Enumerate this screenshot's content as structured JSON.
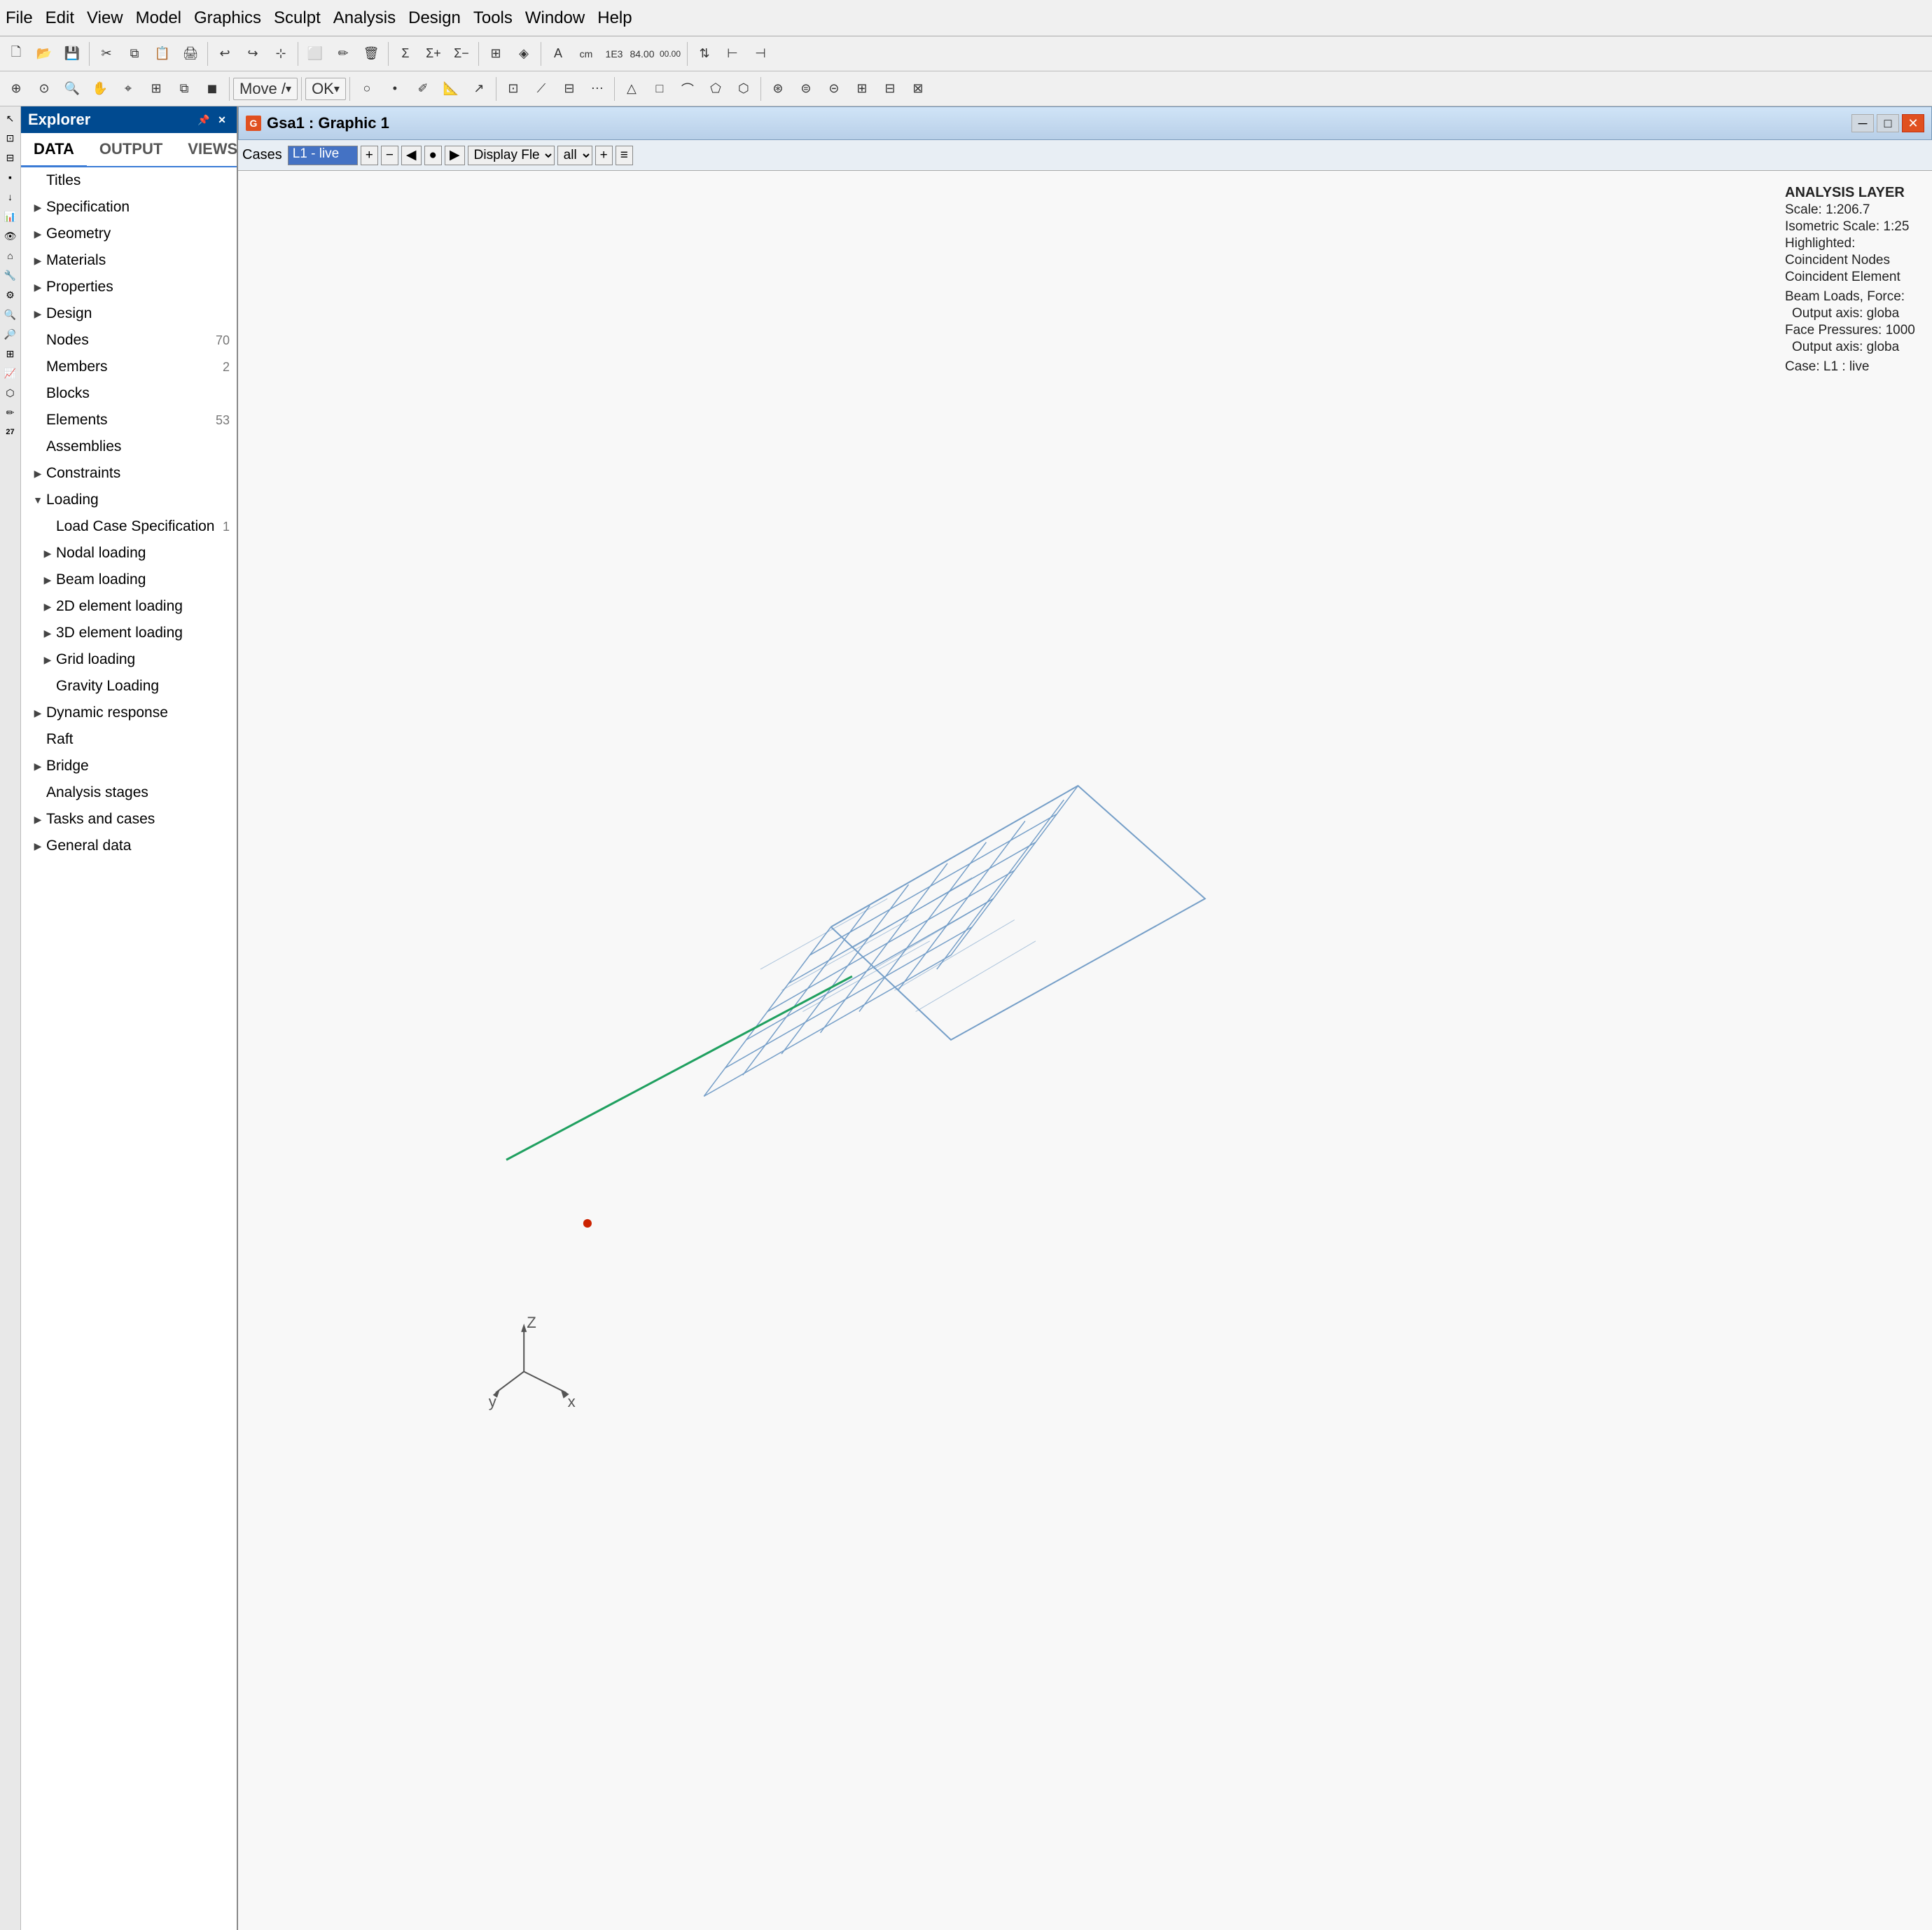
{
  "menubar": {
    "items": [
      "File",
      "Edit",
      "View",
      "Model",
      "Graphics",
      "Sculpt",
      "Analysis",
      "Design",
      "Tools",
      "Window",
      "Help"
    ]
  },
  "explorer": {
    "title": "Explorer",
    "pin_label": "📌",
    "close_label": "✕",
    "tabs": [
      "DATA",
      "OUTPUT",
      "VIEWS"
    ],
    "active_tab": "DATA",
    "tree": [
      {
        "label": "Titles",
        "indent": 0,
        "has_arrow": false,
        "badge": ""
      },
      {
        "label": "Specification",
        "indent": 0,
        "has_arrow": true,
        "badge": ""
      },
      {
        "label": "Geometry",
        "indent": 0,
        "has_arrow": true,
        "badge": ""
      },
      {
        "label": "Materials",
        "indent": 0,
        "has_arrow": true,
        "badge": ""
      },
      {
        "label": "Properties",
        "indent": 0,
        "has_arrow": true,
        "badge": ""
      },
      {
        "label": "Design",
        "indent": 0,
        "has_arrow": true,
        "badge": ""
      },
      {
        "label": "Nodes",
        "indent": 0,
        "has_arrow": false,
        "badge": "70"
      },
      {
        "label": "Members",
        "indent": 0,
        "has_arrow": false,
        "badge": "2"
      },
      {
        "label": "Blocks",
        "indent": 0,
        "has_arrow": false,
        "badge": ""
      },
      {
        "label": "Elements",
        "indent": 0,
        "has_arrow": false,
        "badge": "53"
      },
      {
        "label": "Assemblies",
        "indent": 0,
        "has_arrow": false,
        "badge": ""
      },
      {
        "label": "Constraints",
        "indent": 0,
        "has_arrow": true,
        "badge": ""
      },
      {
        "label": "Loading",
        "indent": 0,
        "has_arrow": true,
        "expanded": true,
        "badge": ""
      },
      {
        "label": "Load Case Specification",
        "indent": 1,
        "has_arrow": false,
        "badge": "1"
      },
      {
        "label": "Nodal loading",
        "indent": 1,
        "has_arrow": true,
        "badge": ""
      },
      {
        "label": "Beam loading",
        "indent": 1,
        "has_arrow": true,
        "badge": ""
      },
      {
        "label": "2D element loading",
        "indent": 1,
        "has_arrow": true,
        "badge": ""
      },
      {
        "label": "3D element loading",
        "indent": 1,
        "has_arrow": true,
        "badge": ""
      },
      {
        "label": "Grid loading",
        "indent": 1,
        "has_arrow": true,
        "badge": ""
      },
      {
        "label": "Gravity Loading",
        "indent": 1,
        "has_arrow": false,
        "badge": ""
      },
      {
        "label": "Dynamic response",
        "indent": 0,
        "has_arrow": true,
        "badge": ""
      },
      {
        "label": "Raft",
        "indent": 0,
        "has_arrow": false,
        "badge": ""
      },
      {
        "label": "Bridge",
        "indent": 0,
        "has_arrow": true,
        "badge": ""
      },
      {
        "label": "Analysis stages",
        "indent": 0,
        "has_arrow": false,
        "badge": ""
      },
      {
        "label": "Tasks and cases",
        "indent": 0,
        "has_arrow": true,
        "badge": ""
      },
      {
        "label": "General data",
        "indent": 0,
        "has_arrow": true,
        "badge": ""
      }
    ]
  },
  "window": {
    "title": "Gsa1 : Graphic 1",
    "icon": "G",
    "controls": [
      "─",
      "□",
      "✕"
    ]
  },
  "graphic_toolbar": {
    "cases_label": "Cases",
    "cases_value": "L1 - live",
    "display_label": "Display Fle",
    "display_value": "all"
  },
  "analysis_layer": {
    "title": "ANALYSIS LAYER",
    "scale": "Scale: 1:206.7",
    "iso_scale": "Isometric Scale: 1:25",
    "highlighted": "Highlighted:",
    "coincident_nodes": "Coincident Nodes",
    "coincident_elements": "Coincident Element",
    "beam_loads": "Beam Loads, Force:",
    "output_axis1": "Output axis: globa",
    "face_pressures": "Face Pressures: 1000",
    "output_axis2": "Output axis: globa",
    "case": "Case: L1 : live"
  },
  "icons": {
    "arrow_right": "▶",
    "arrow_down": "▼",
    "pin": "📌",
    "close": "✕",
    "minimize": "─",
    "maximize": "□"
  }
}
